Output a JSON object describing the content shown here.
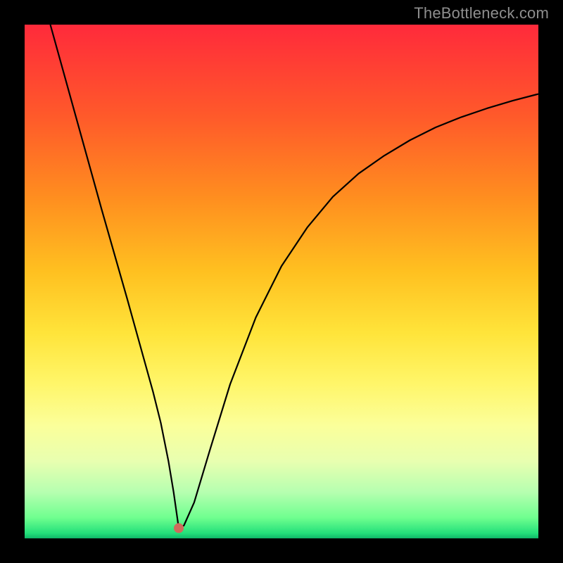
{
  "watermark": "TheBottleneck.com",
  "chart_data": {
    "type": "line",
    "title": "",
    "xlabel": "",
    "ylabel": "",
    "xlim": [
      0,
      100
    ],
    "ylim": [
      0,
      100
    ],
    "grid": false,
    "legend": false,
    "annotations": [
      {
        "name": "cusp-point",
        "x": 30,
        "y": 2,
        "color": "#cf6b5b"
      }
    ],
    "series": [
      {
        "name": "bottleneck-curve",
        "x": [
          5,
          10,
          15,
          20,
          22.5,
          25,
          26.5,
          28,
          29,
          30,
          31,
          33,
          36,
          40,
          45,
          50,
          55,
          60,
          65,
          70,
          75,
          80,
          85,
          90,
          95,
          100
        ],
        "values": [
          100,
          82,
          64,
          46.5,
          37.5,
          28.5,
          22.5,
          15,
          9,
          2,
          2.5,
          7,
          17,
          30,
          43,
          53,
          60.5,
          66.5,
          71,
          74.5,
          77.5,
          80,
          82,
          83.7,
          85.2,
          86.5
        ]
      }
    ]
  },
  "colors": {
    "watermark": "#8e8e8e",
    "curve": "#000000",
    "cusp_dot": "#cf6b5b",
    "frame": "#000000"
  }
}
